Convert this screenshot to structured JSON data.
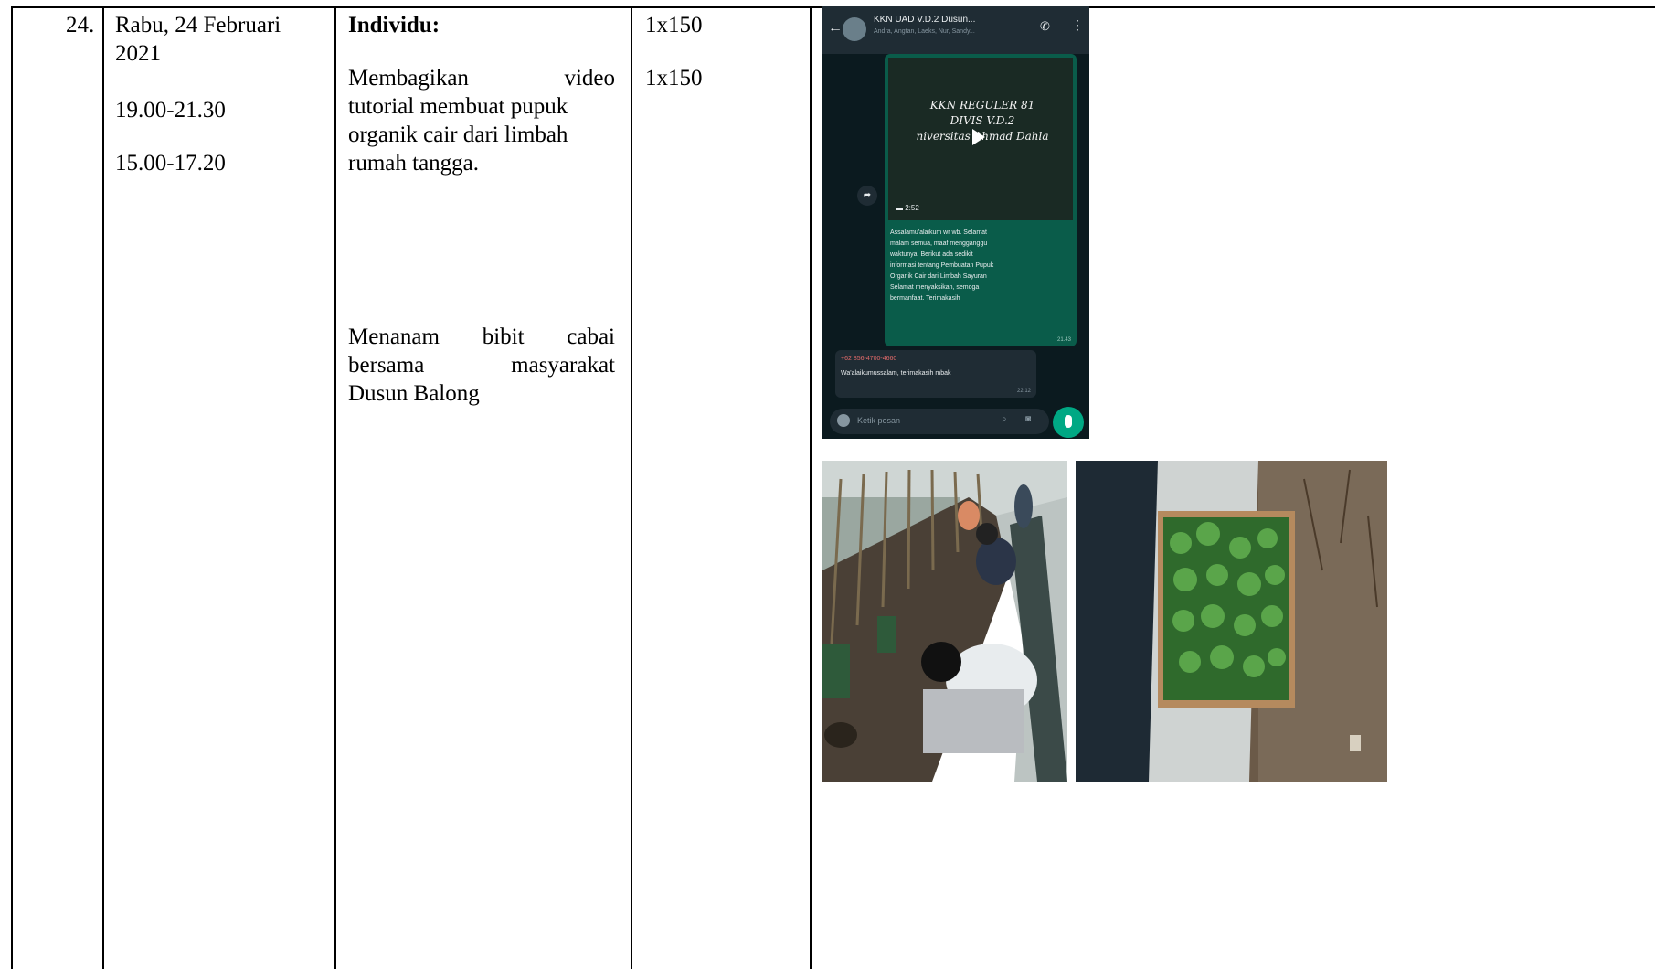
{
  "row": {
    "number": "24.",
    "day_date": [
      "Rabu, 24 Februari",
      "2021"
    ],
    "time1": "19.00-21.30",
    "time2": "15.00-17.20",
    "category": "Individu:",
    "activity1_lines": [
      [
        "Membagikan",
        "video"
      ],
      [
        "tutorial membuat pupuk"
      ],
      [
        "organik cair dari limbah"
      ],
      [
        "rumah tangga."
      ]
    ],
    "activity2_lines": [
      [
        "Menanam",
        "bibit",
        "cabai"
      ],
      [
        "bersama",
        "masyarakat"
      ],
      [
        "Dusun Balong"
      ]
    ],
    "volume1": "1x150",
    "volume2": "1x150"
  },
  "screenshot": {
    "group_name": "KKN UAD V.D.2 Dusun...",
    "members": "Andra, Angtan, Laeks, Nur, Sandy...",
    "video_title_lines": [
      "KKN REGULER 81",
      "DIVIS V.D.2",
      "niversitas Ahmad Dahla"
    ],
    "video_duration": "2:52",
    "message_lines": [
      "Assalamu'alaikum wr wb. Selamat",
      "malam semua, maaf mengganggu",
      "waktunya. Berikut ada sedikit",
      "informasi tentang Pembuatan Pupuk",
      "Organik Cair dari Limbah Sayuran",
      "Selamat menyaksikan, semoga",
      "bermanfaat. Terimakasih"
    ],
    "message_time": "21.43",
    "reply_sender": "+62 856-4700-4660",
    "reply_text": "Wa'alaikumussalam, terimakasih mbak",
    "reply_time": "22.12",
    "input_placeholder": "Ketik pesan"
  },
  "colors": {
    "wa_bg": "#0b1a1f",
    "wa_header": "#1f2c34",
    "wa_bubble_out": "#0a5c4a",
    "wa_bubble_in": "#1f2c34",
    "wa_mic": "#00a884"
  }
}
